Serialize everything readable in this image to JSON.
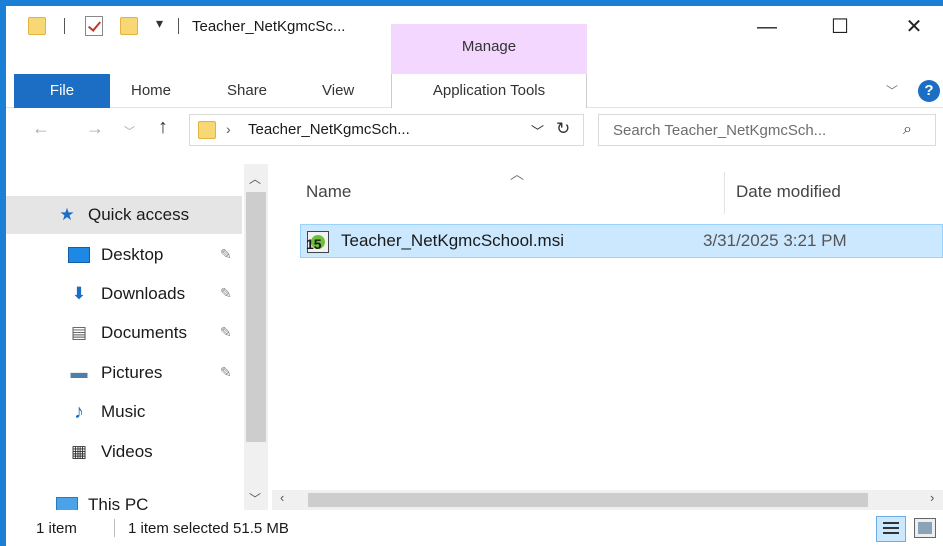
{
  "title": "Teacher_NetKgmcSc...",
  "contextual_tab": "Manage",
  "window_controls": {
    "minimize": "—",
    "maximize": "☐",
    "close": "✕"
  },
  "ribbon": {
    "file": "File",
    "tabs": [
      "Home",
      "Share",
      "View"
    ],
    "app_tools": "Application Tools",
    "help": "?"
  },
  "address": {
    "path": "Teacher_NetKgmcSch...",
    "separator": "›"
  },
  "search": {
    "placeholder": "Search Teacher_NetKgmcSch..."
  },
  "nav": {
    "items": [
      {
        "label": "Quick access",
        "icon": "star-icon"
      },
      {
        "label": "Desktop",
        "icon": "desktop-icon",
        "pinned": true
      },
      {
        "label": "Downloads",
        "icon": "download-arrow-icon",
        "pinned": true
      },
      {
        "label": "Documents",
        "icon": "document-icon",
        "pinned": true
      },
      {
        "label": "Pictures",
        "icon": "pictures-icon",
        "pinned": true
      },
      {
        "label": "Music",
        "icon": "music-note-icon"
      },
      {
        "label": "Videos",
        "icon": "film-icon"
      },
      {
        "label": "This PC",
        "icon": "computer-icon"
      }
    ]
  },
  "columns": {
    "name": "Name",
    "date": "Date modified"
  },
  "files": [
    {
      "name": "Teacher_NetKgmcSchool.msi",
      "date": "3/31/2025 3:21 PM",
      "icon": "msi-installer-icon",
      "selected": true
    }
  ],
  "status": {
    "count": "1 item",
    "selection": "1 item selected  51.5 MB"
  }
}
